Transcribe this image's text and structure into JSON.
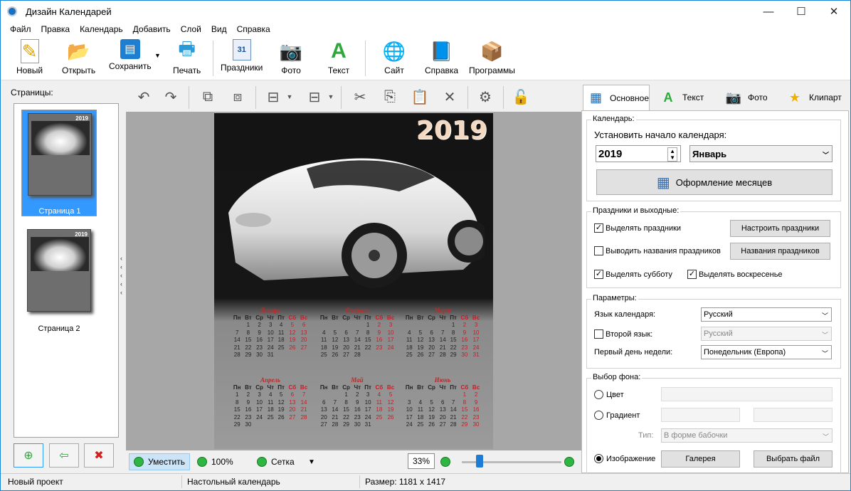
{
  "window": {
    "title": "Дизайн Календарей",
    "minimize": "—",
    "maximize": "☐",
    "close": "✕"
  },
  "menu": [
    "Файл",
    "Правка",
    "Календарь",
    "Добавить",
    "Слой",
    "Вид",
    "Справка"
  ],
  "toolbar": {
    "new": "Новый",
    "open": "Открыть",
    "save": "Сохранить",
    "print": "Печать",
    "holidays": "Праздники",
    "photo": "Фото",
    "text": "Текст",
    "site": "Сайт",
    "help": "Справка",
    "programs": "Программы"
  },
  "pages": {
    "label": "Страницы:",
    "items": [
      {
        "caption": "Страница 1",
        "year": "2019"
      },
      {
        "caption": "Страница 2",
        "year": "2019"
      }
    ]
  },
  "poster": {
    "year": "2019",
    "weekdays": [
      "Пн",
      "Вт",
      "Ср",
      "Чт",
      "Пт",
      "Сб",
      "Вс"
    ],
    "months": [
      {
        "name": "Январь",
        "rows": [
          [
            "",
            "1",
            "2",
            "3",
            "4",
            "5",
            "6"
          ],
          [
            "7",
            "8",
            "9",
            "10",
            "11",
            "12",
            "13"
          ],
          [
            "14",
            "15",
            "16",
            "17",
            "18",
            "19",
            "20"
          ],
          [
            "21",
            "22",
            "23",
            "24",
            "25",
            "26",
            "27"
          ],
          [
            "28",
            "29",
            "30",
            "31",
            "",
            "",
            ""
          ]
        ]
      },
      {
        "name": "Февраль",
        "rows": [
          [
            "",
            "",
            "",
            "",
            "1",
            "2",
            "3"
          ],
          [
            "4",
            "5",
            "6",
            "7",
            "8",
            "9",
            "10"
          ],
          [
            "11",
            "12",
            "13",
            "14",
            "15",
            "16",
            "17"
          ],
          [
            "18",
            "19",
            "20",
            "21",
            "22",
            "23",
            "24"
          ],
          [
            "25",
            "26",
            "27",
            "28",
            "",
            "",
            ""
          ]
        ]
      },
      {
        "name": "Март",
        "rows": [
          [
            "",
            "",
            "",
            "",
            "1",
            "2",
            "3"
          ],
          [
            "4",
            "5",
            "6",
            "7",
            "8",
            "9",
            "10"
          ],
          [
            "11",
            "12",
            "13",
            "14",
            "15",
            "16",
            "17"
          ],
          [
            "18",
            "19",
            "20",
            "21",
            "22",
            "23",
            "24"
          ],
          [
            "25",
            "26",
            "27",
            "28",
            "29",
            "30",
            "31"
          ]
        ]
      },
      {
        "name": "Апрель",
        "rows": [
          [
            "1",
            "2",
            "3",
            "4",
            "5",
            "6",
            "7"
          ],
          [
            "8",
            "9",
            "10",
            "11",
            "12",
            "13",
            "14"
          ],
          [
            "15",
            "16",
            "17",
            "18",
            "19",
            "20",
            "21"
          ],
          [
            "22",
            "23",
            "24",
            "25",
            "26",
            "27",
            "28"
          ],
          [
            "29",
            "30",
            "",
            "",
            "",
            "",
            ""
          ]
        ]
      },
      {
        "name": "Май",
        "rows": [
          [
            "",
            "",
            "1",
            "2",
            "3",
            "4",
            "5"
          ],
          [
            "6",
            "7",
            "8",
            "9",
            "10",
            "11",
            "12"
          ],
          [
            "13",
            "14",
            "15",
            "16",
            "17",
            "18",
            "19"
          ],
          [
            "20",
            "21",
            "22",
            "23",
            "24",
            "25",
            "26"
          ],
          [
            "27",
            "28",
            "29",
            "30",
            "31",
            "",
            ""
          ]
        ]
      },
      {
        "name": "Июнь",
        "rows": [
          [
            "",
            "",
            "",
            "",
            "",
            "1",
            "2"
          ],
          [
            "3",
            "4",
            "5",
            "6",
            "7",
            "8",
            "9"
          ],
          [
            "10",
            "11",
            "12",
            "13",
            "14",
            "15",
            "16"
          ],
          [
            "17",
            "18",
            "19",
            "20",
            "21",
            "22",
            "23"
          ],
          [
            "24",
            "25",
            "26",
            "27",
            "28",
            "29",
            "30"
          ]
        ]
      }
    ]
  },
  "editor_bottom": {
    "fit": "Уместить",
    "zoom100": "100%",
    "grid": "Сетка",
    "zoom_value": "33%",
    "zoom_fraction": 0.18
  },
  "tabs": {
    "main": "Основное",
    "text": "Текст",
    "photo": "Фото",
    "clipart": "Клипарт"
  },
  "calendar_group": {
    "title": "Календарь:",
    "start_label": "Установить начало календаря:",
    "year": "2019",
    "month": "Январь",
    "design_button": "Оформление месяцев"
  },
  "holidays_group": {
    "title": "Праздники и выходные:",
    "highlight_holidays": "Выделять праздники",
    "setup_holidays": "Настроить праздники",
    "show_names": "Выводить названия праздников",
    "names_button": "Названия праздников",
    "highlight_saturday": "Выделять субботу",
    "highlight_sunday": "Выделять воскресенье"
  },
  "params_group": {
    "title": "Параметры:",
    "language_label": "Язык календаря:",
    "language": "Русский",
    "second_language": "Второй язык:",
    "second_language_value": "Русский",
    "first_day_label": "Первый день недели:",
    "first_day": "Понедельник (Европа)"
  },
  "background_group": {
    "title": "Выбор фона:",
    "color": "Цвет",
    "gradient": "Градиент",
    "type_label": "Тип:",
    "type_value": "В форме бабочки",
    "image": "Изображение",
    "gallery": "Галерея",
    "choose_file": "Выбрать файл"
  },
  "status": {
    "project": "Новый проект",
    "type": "Настольный календарь",
    "size": "Размер: 1181 x 1417"
  }
}
